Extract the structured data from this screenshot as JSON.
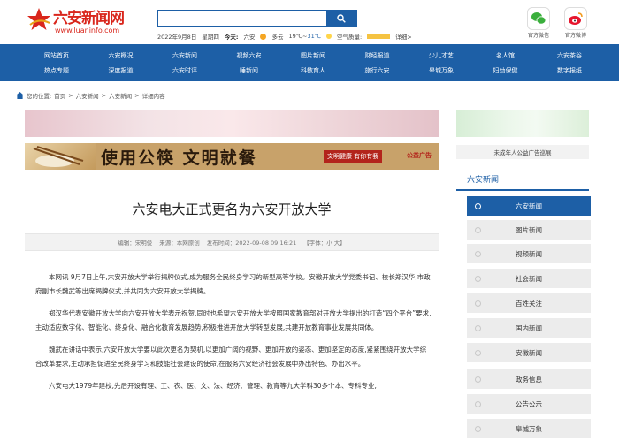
{
  "header": {
    "logo_text": "六安新闻网",
    "logo_url": "www.luaninfo.com",
    "search_placeholder": "",
    "info": {
      "date": "2022年9月8日",
      "weekday": "星期四",
      "today_label": "今天:",
      "city": "六安",
      "weather": "多云",
      "temp_low": "19℃~",
      "temp_high": "31℃",
      "air_label": "空气质量:",
      "detail": "详细>"
    },
    "social": [
      {
        "label": "官方微信",
        "icon": "wechat-icon",
        "color": "#3aaf3c"
      },
      {
        "label": "官方微博",
        "icon": "weibo-icon",
        "color": "#e6162d"
      }
    ]
  },
  "nav": {
    "row1": [
      "网站首页",
      "六安概况",
      "六安新闻",
      "视频六安",
      "图片新闻",
      "财经报道",
      "少儿才艺",
      "名人馆",
      "六安茶谷"
    ],
    "row2": [
      "热点专题",
      "深度报道",
      "六安时评",
      "睡新闻",
      "科教育人",
      "旅行六安",
      "皋城万象",
      "妇幼保健",
      "数字报纸"
    ]
  },
  "breadcrumb": {
    "prefix": "您的位置:",
    "items": [
      "首页",
      "六安新闻",
      "六安新闻",
      "详细内容"
    ],
    "sep": ">"
  },
  "banner": {
    "title": "使用公筷 文明就餐",
    "tag": "文明健康 有你有我",
    "publisher": "公益广告"
  },
  "article": {
    "title": "六安电大正式更名为六安开放大学",
    "meta": {
      "editor": "编辑：宋明俊",
      "source": "来源：本网原创",
      "time": "发布时间：2022-09-08 09:16:21",
      "font": "【字体：小 大】"
    },
    "paragraphs": [
      "本网讯 9月7日上午,六安开放大学举行揭牌仪式,成为服务全民终身学习的新型高等学校。安徽开放大学党委书记、校长郑汉华,市政府副市长魏武等出席揭牌仪式,并共同为六安开放大学揭牌。",
      "郑汉华代表安徽开放大学向六安开放大学表示祝贺,同时也希望六安开放大学按照国家教育部对开放大学提出的打造“四个平台”要求,主动适应数字化、智能化、终身化、融合化教育发展趋势,积极推进开放大学转型发展,共建开放教育事业发展共同体。",
      "魏武在讲话中表示,六安开放大学要以此次更名为契机,以更加广阔的视野、更加开放的姿态、更加坚定的态度,紧紧围绕开放大学综合改革要求,主动承担促进全民终身学习和技能社会建设的使命,在服务六安经济社会发展中办出特色、办出水平。",
      "六安电大1979年建校,先后开设有理、工、农、医、文、法、经济、管理、教育等九大学科30多个本、专科专业,"
    ]
  },
  "sidebar": {
    "ad_caption": "未成年人公益广告巡展",
    "section_title": "六安新闻",
    "items": [
      "六安新闻",
      "图片新闻",
      "视频新闻",
      "社会新闻",
      "百姓关注",
      "国内新闻",
      "安徽新闻",
      "政务信息",
      "公告公示",
      "皋城万象"
    ],
    "active_index": 0
  },
  "colors": {
    "primary": "#1d5fa6",
    "logo_red": "#d9261c"
  }
}
